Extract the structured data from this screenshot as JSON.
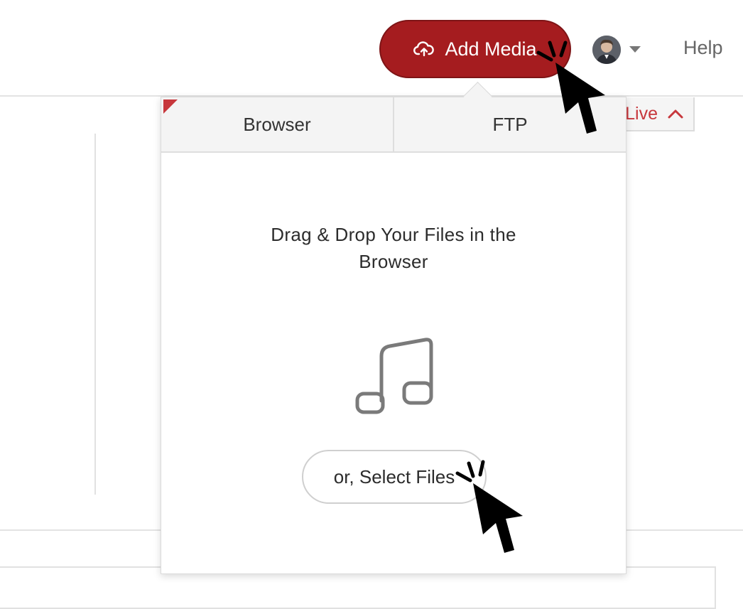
{
  "header": {
    "add_media_label": "Add Media",
    "add_media_icon": "cloud-upload-icon",
    "avatar_icon": "user-avatar",
    "help_label": "Help",
    "accent_color": "#a51c1f"
  },
  "background": {
    "go_live_label": "Live",
    "go_live_icon": "chevron-up-icon"
  },
  "upload_popover": {
    "tabs": [
      {
        "label": "Browser"
      },
      {
        "label": "FTP"
      }
    ],
    "drop_text_line1": "Drag & Drop Your Files in the",
    "drop_text_line2": "Browser",
    "file_type_icon": "music-note-icon",
    "select_files_label": "or, Select Files"
  },
  "cursors": [
    {
      "icon": "click-cursor-icon",
      "target": "Add Media"
    },
    {
      "icon": "click-cursor-icon",
      "target": "or, Select Files"
    }
  ]
}
